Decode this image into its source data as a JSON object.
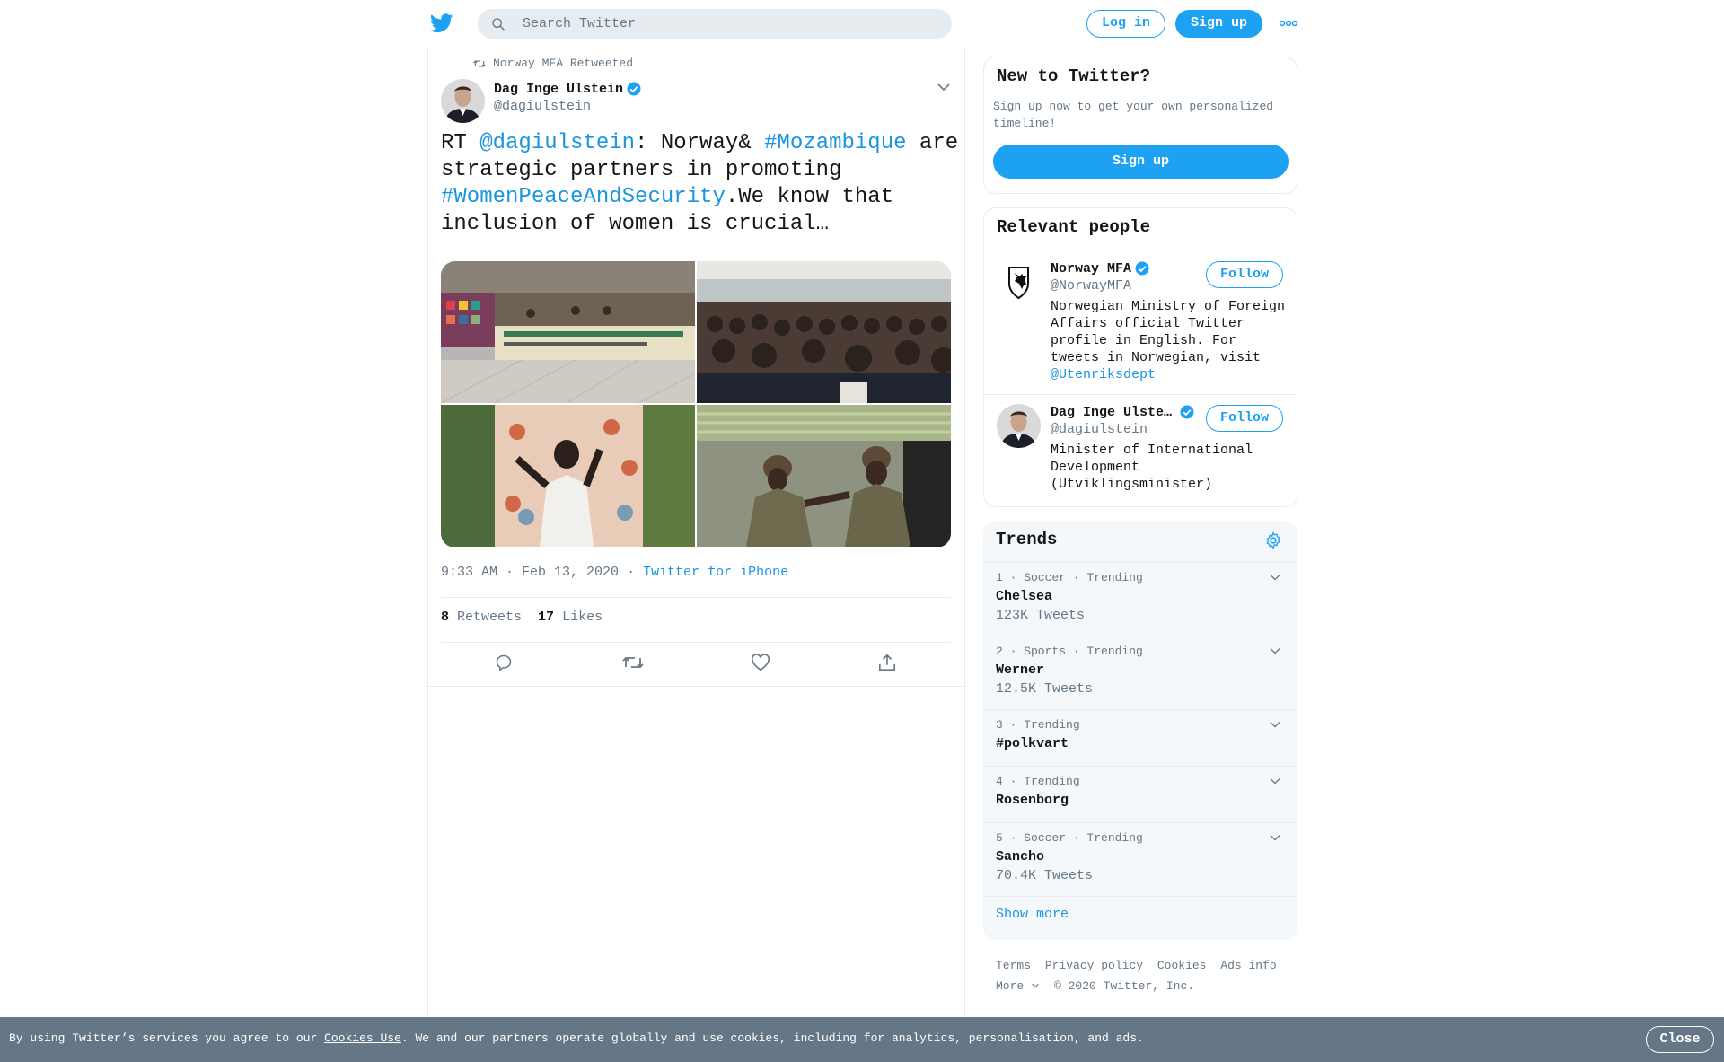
{
  "header": {
    "search_placeholder": "Search Twitter",
    "login_label": "Log in",
    "signup_label": "Sign up"
  },
  "tweet": {
    "retweeted_by": "Norway MFA Retweeted",
    "author_name": "Dag Inge Ulstein",
    "author_handle": "@dagiulstein",
    "text": {
      "p1": "RT ",
      "mention": "@dagiulstein",
      "p2": ": Norway& ",
      "hashtag1": "#Mozambique",
      "p3": " are strategic partners in promoting ",
      "hashtag2": "#WomenPeaceAndSecurity",
      "p4": ".We know that inclusion of women is crucial…"
    },
    "timestamp": "9:33 AM · Feb 13, 2020",
    "source": "Twitter for iPhone",
    "retweets_count": "8",
    "retweets_label": "Retweets",
    "likes_count": "17",
    "likes_label": "Likes"
  },
  "sidebar": {
    "new_title": "New to Twitter?",
    "new_text": "Sign up now to get your own personalized timeline!",
    "new_signup": "Sign up",
    "people_title": "Relevant people",
    "people": [
      {
        "name": "Norway MFA",
        "handle": "@NorwayMFA",
        "bio": "Norwegian Ministry of Foreign Affairs official Twitter profile in English. For tweets in Norwegian, visit ",
        "bio_link": "@Utenriksdept",
        "follow": "Follow"
      },
      {
        "name": "Dag Inge Ulste…",
        "handle": "@dagiulstein",
        "bio": "Minister of International Development (Utviklingsminister)",
        "follow": "Follow"
      }
    ],
    "trends_title": "Trends",
    "trends": [
      {
        "meta": "1 · Soccer · Trending",
        "name": "Chelsea",
        "count": "123K Tweets"
      },
      {
        "meta": "2 · Sports · Trending",
        "name": "Werner",
        "count": "12.5K Tweets"
      },
      {
        "meta": "3 · Trending",
        "name": "#polkvart",
        "count": ""
      },
      {
        "meta": "4 · Trending",
        "name": "Rosenborg",
        "count": ""
      },
      {
        "meta": "5 · Soccer · Trending",
        "name": "Sancho",
        "count": "70.4K Tweets"
      }
    ],
    "show_more": "Show more",
    "footer": {
      "terms": "Terms",
      "privacy": "Privacy policy",
      "cookies": "Cookies",
      "ads": "Ads info",
      "more": "More",
      "copyright": "© 2020 Twitter, Inc."
    }
  },
  "cookie_bar": {
    "text_before": "By using Twitter’s services you agree to our ",
    "link": "Cookies Use",
    "text_after": ". We and our partners operate globally and use cookies, including for analytics, personalisation, and ads.",
    "close": "Close"
  },
  "colors": {
    "accent": "#1da1f2",
    "link": "#1b95e0",
    "muted": "#657786",
    "border": "#e6ecf0",
    "cookie_bg": "#657786"
  }
}
